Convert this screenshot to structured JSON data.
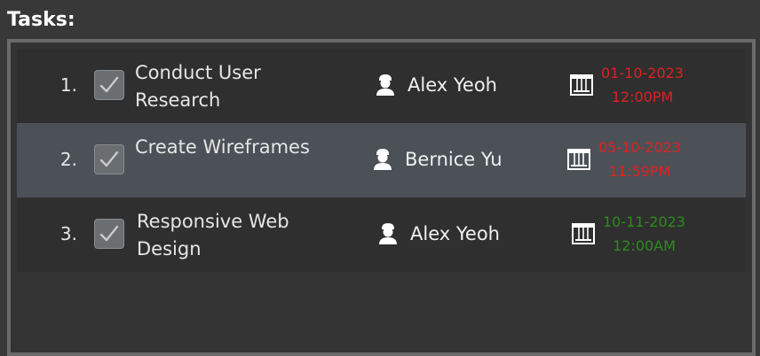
{
  "header": {
    "title": "Tasks:"
  },
  "colors": {
    "overdue": "#e02020",
    "upcoming": "#2f8a1e",
    "selected_row": "#4b5157"
  },
  "tasks": [
    {
      "index": "1.",
      "title": "Conduct User Research",
      "assignee": "Alex Yeoh",
      "due_date": "01-10-2023",
      "due_time": "12:00PM",
      "status": "overdue",
      "checked": true,
      "selected": false
    },
    {
      "index": "2.",
      "title": "Create Wireframes",
      "assignee": "Bernice Yu",
      "due_date": "05-10-2023",
      "due_time": "11:59PM",
      "status": "overdue",
      "checked": true,
      "selected": true
    },
    {
      "index": "3.",
      "title": "Responsive Web Design",
      "assignee": "Alex Yeoh",
      "due_date": "10-11-2023",
      "due_time": "12:00AM",
      "status": "upcoming",
      "checked": true,
      "selected": false
    }
  ],
  "icons": {
    "check": "checkmark-icon",
    "assignee": "person-icon",
    "due": "calendar-icon"
  }
}
